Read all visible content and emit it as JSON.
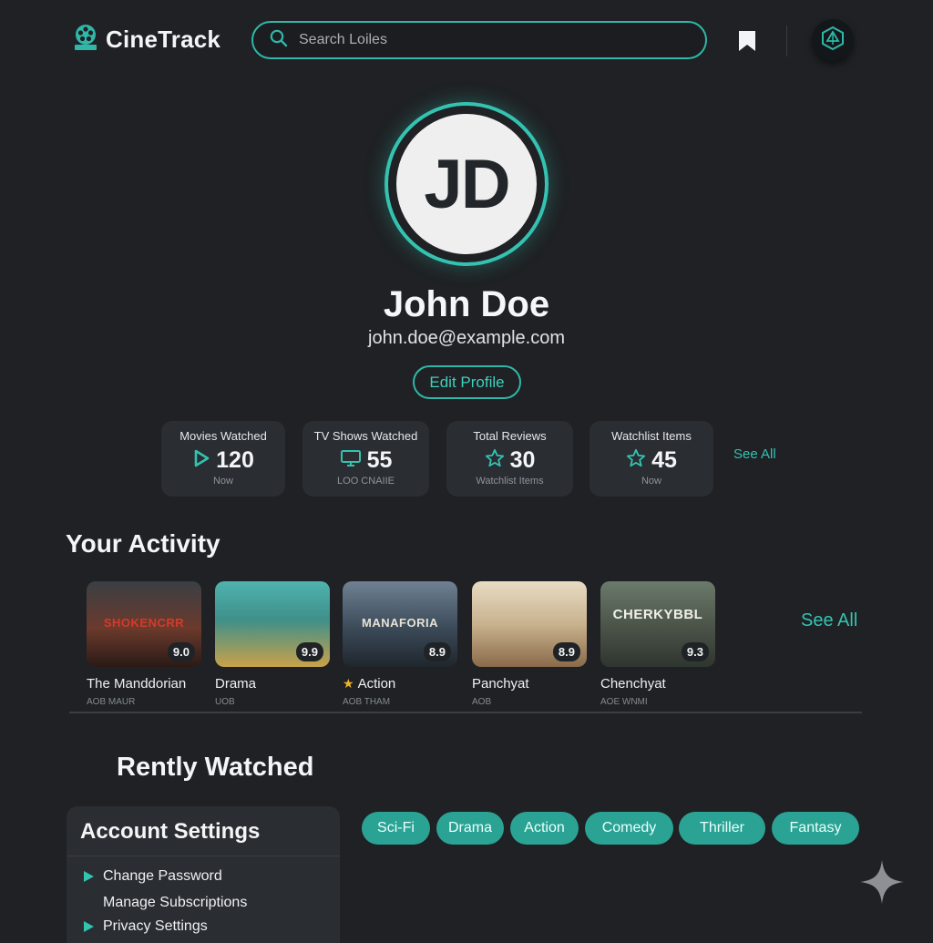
{
  "app": {
    "brand": "CineTrack"
  },
  "search": {
    "placeholder": "Search Loiles"
  },
  "profile": {
    "initials": "JD",
    "name": "John Doe",
    "email": "john.doe@example.com",
    "edit_label": "Edit Profile"
  },
  "stats": {
    "items": [
      {
        "label": "Movies Watched",
        "value": "120",
        "sub": "Now",
        "icon": "play-icon"
      },
      {
        "label": "TV Shows Watched",
        "value": "55",
        "sub": "LOO CNAIIE",
        "icon": "monitor-icon"
      },
      {
        "label": "Total Reviews",
        "value": "30",
        "sub": "Watchlist Items",
        "icon": "star-icon"
      },
      {
        "label": "Watchlist Items",
        "value": "45",
        "sub": "Now",
        "icon": "star-icon"
      }
    ],
    "see_all": "See All"
  },
  "activity": {
    "title": "Your Activity",
    "see_all": "See All",
    "items": [
      {
        "title": "The Manddorian",
        "meta": "AOB MAUR",
        "rating": "9.0",
        "poster_text": "SHOKENCRR",
        "color": "#6b3a2c"
      },
      {
        "title": "Drama",
        "meta": "UOB",
        "rating": "9.9",
        "poster_text": "",
        "color": "#3f8f8a"
      },
      {
        "title": "Action",
        "meta": "AOB THAM",
        "rating": "8.9",
        "poster_text": "MANAFORIA",
        "color": "#3b4a58",
        "starred": true
      },
      {
        "title": "Panchyat",
        "meta": "AOB",
        "rating": "8.9",
        "poster_text": "",
        "color": "#c9b28e"
      },
      {
        "title": "Chenchyat",
        "meta": "AOE WNMI",
        "rating": "9.3",
        "poster_text": "CHERKYBBL",
        "color": "#4a5248"
      }
    ]
  },
  "recent": {
    "title": "Rently Watched"
  },
  "account": {
    "title": "Account Settings",
    "items": [
      {
        "label": "Change Password",
        "arrow": true
      },
      {
        "label": "Manage Subscriptions",
        "arrow": false
      },
      {
        "label": "Privacy Settings",
        "arrow": true
      }
    ]
  },
  "genres": [
    "Sci-Fi",
    "Drama",
    "Action",
    "Comedy",
    "Thriller",
    "Fantasy"
  ],
  "colors": {
    "accent": "#2fb7a9",
    "background": "#1f2124",
    "card": "#2a2d31",
    "chip": "#2aa394"
  }
}
